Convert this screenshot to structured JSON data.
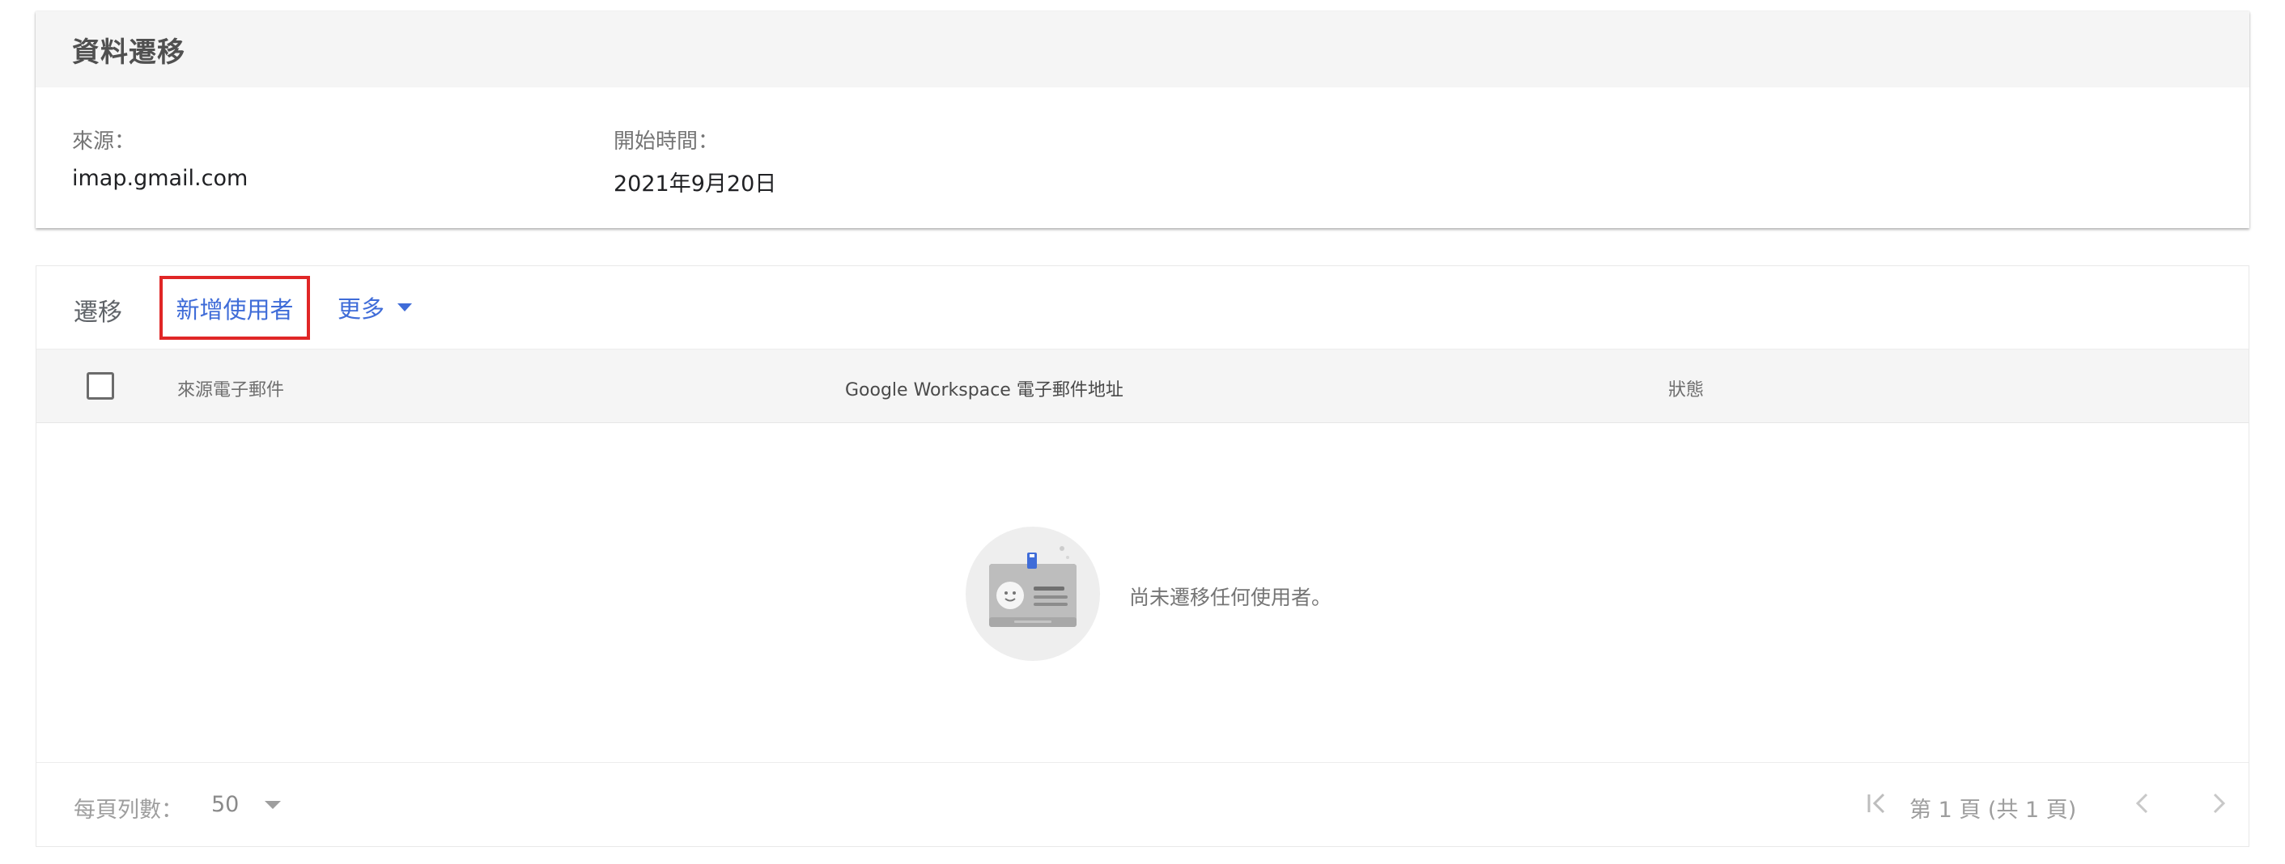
{
  "summary": {
    "title": "資料遷移",
    "source_label": "來源：",
    "source_value": "imap.gmail.com",
    "start_label": "開始時間：",
    "start_value": "2021年9月20日"
  },
  "toolbar": {
    "title": "遷移",
    "add_user_label": "新增使用者",
    "more_label": "更多"
  },
  "table": {
    "columns": [
      "來源電子郵件",
      "Google Workspace 電子郵件地址",
      "狀態"
    ],
    "rows": [],
    "empty_message": "尚未遷移任何使用者。"
  },
  "footer": {
    "rows_per_page_label": "每頁列數：",
    "rows_per_page_value": "50",
    "page_info": "第 1 頁 (共 1 頁)"
  },
  "colors": {
    "accent": "#3f6cd8",
    "highlight_border": "#e02626",
    "header_bg": "#f5f5f5"
  },
  "icons": [
    "chevron-down-icon",
    "checkbox-icon",
    "id-card-illustration",
    "first-page-icon",
    "chevron-left-icon",
    "chevron-right-icon"
  ]
}
